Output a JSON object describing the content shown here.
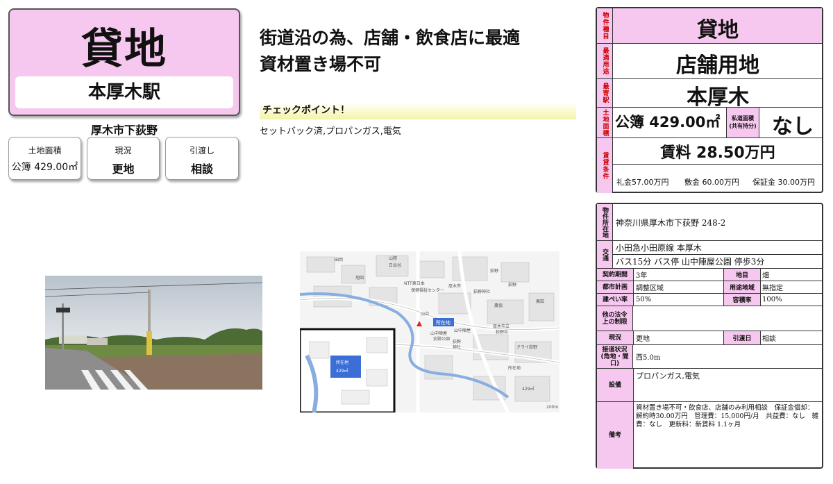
{
  "badge": {
    "title": "貸地",
    "station": "本厚木駅",
    "address_short": "厚木市下荻野"
  },
  "summary_cards": [
    {
      "label": "土地面積",
      "value": "公簿 429.00㎡"
    },
    {
      "label": "現況",
      "value": "更地"
    },
    {
      "label": "引渡し",
      "value": "相談"
    }
  ],
  "headline": {
    "line1": "街道沿の為、店舗・飲食店に最適",
    "line2": "資材置き場不可"
  },
  "checkpoint": {
    "title": "チェックポイント！",
    "text": "セットバック済,プロパンガス,電気"
  },
  "map": {
    "labels": [
      "山際",
      "田岡",
      "日出谷",
      "NTT東日本",
      "厚木市",
      "荻野",
      "山中",
      "保健福祉センター",
      "栗田",
      "山中陣屋",
      "史跡公園",
      "荻野",
      "農協",
      "厚木市立",
      "荻野中",
      "荻野神社",
      "クライ荻野",
      "山中陣屋",
      "荻野",
      "神社",
      "地図",
      "所在地",
      "429㎡",
      "200m"
    ],
    "inset_label": "所在地",
    "inset_area": "429㎡",
    "scale": "200m"
  },
  "property": {
    "type_label": "物件種目",
    "type_value": "貸地",
    "use_label": "最適用途",
    "use_value": "店舗用地",
    "station_label": "最寄駅",
    "station_value": "本厚木",
    "area_label": "土地面積",
    "area_value": "公簿 429.00㎡",
    "private_road_label": "私道面積",
    "private_road_sub": "(共有持分)",
    "private_road_value": "なし",
    "rent_label": "賃貸条件",
    "rent_value": "賃料 28.50万円",
    "reikin": "礼金57.00万円",
    "shikikin": "敷金 60.00万円",
    "hoshokin": "保証金 30.00万円"
  },
  "detail": {
    "location_label": "物件所在地",
    "location_value": "神奈川県厚木市下荻野 248-2",
    "transport_label": "交通",
    "transport_line1": "小田急小田原線 本厚木",
    "transport_line2": "バス15分 バス停 山中陣屋公園 停歩3分",
    "contract_label": "契約期間",
    "contract_value": "3年",
    "land_cat_label": "地目",
    "land_cat_value": "畑",
    "city_plan_label": "都市計画",
    "city_plan_value": "調整区域",
    "zoning_label": "用途地域",
    "zoning_value": "無指定",
    "bcr_label": "建ぺい率",
    "bcr_value": "50%",
    "far_label": "容積率",
    "far_value": "100%",
    "other_law_label": "他の法令上の制限",
    "other_law_value": "",
    "status_label": "現況",
    "status_value": "更地",
    "handover_label": "引渡日",
    "handover_value": "相談",
    "road_label": "接道状況(角地・間口)",
    "road_value": "西5.0m",
    "facility_label": "設備",
    "facility_value": "プロパンガス,電気",
    "remarks_label": "備考",
    "remarks_value": "資材置き場不可・飲食店、店舗のみ利用相談　保証金償却：解約時30.00万円　管理費：15,000円/月　共益費：なし　雑費：なし　更新料：新賃料 1.1ヶ月"
  },
  "colors": {
    "accent_pink": "#f7c8ef",
    "label_red": "#cc0000",
    "check_yellow": "#f4f4a8"
  }
}
